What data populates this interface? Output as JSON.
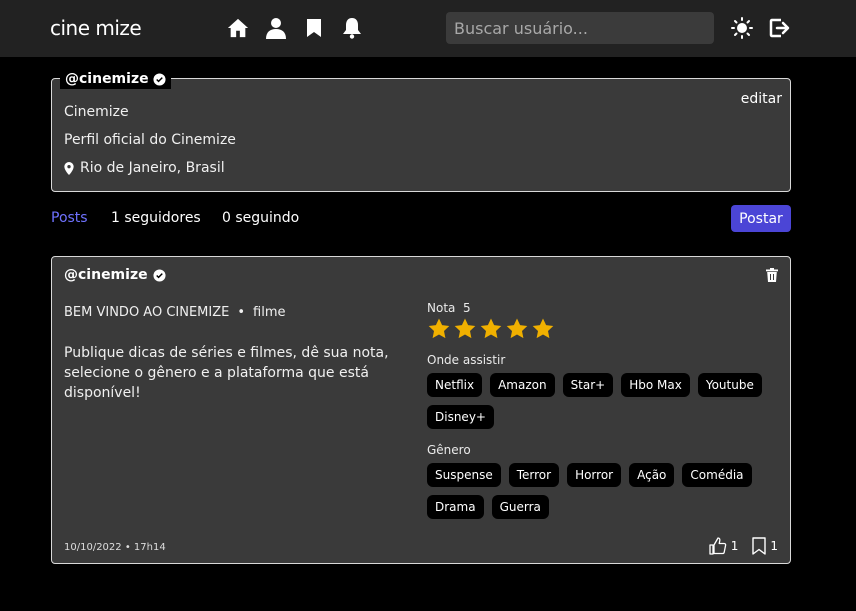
{
  "header": {
    "logo": "cine mize",
    "search_placeholder": "Buscar usuário..."
  },
  "profile": {
    "handle": "@cinemize",
    "edit_label": "editar",
    "name": "Cinemize",
    "bio": "Perfil oficial do Cinemize",
    "location": "Rio de Janeiro, Brasil"
  },
  "tabs": {
    "posts": "Posts",
    "followers": "1 seguidores",
    "following": "0 seguindo",
    "post_button": "Postar"
  },
  "post": {
    "handle": "@cinemize",
    "title": "BEM VINDO AO CINEMIZE",
    "separator": "•",
    "type": "filme",
    "description": "Publique dicas de séries e filmes, dê sua nota, selecione o gênero e a plataforma que está disponível!",
    "rating_label": "Nota",
    "rating_value": "5",
    "rating_stars": 5,
    "where_label": "Onde assistir",
    "platforms": [
      "Netflix",
      "Amazon",
      "Star+",
      "Hbo Max",
      "Youtube",
      "Disney+"
    ],
    "genre_label": "Gênero",
    "genres": [
      "Suspense",
      "Terror",
      "Horror",
      "Ação",
      "Comédia",
      "Drama",
      "Guerra"
    ],
    "date": "10/10/2022 • 17h14",
    "likes": "1",
    "saves": "1"
  },
  "colors": {
    "accent": "#4b45d6",
    "star": "#f0b000",
    "tab_active": "#6f72ff"
  }
}
